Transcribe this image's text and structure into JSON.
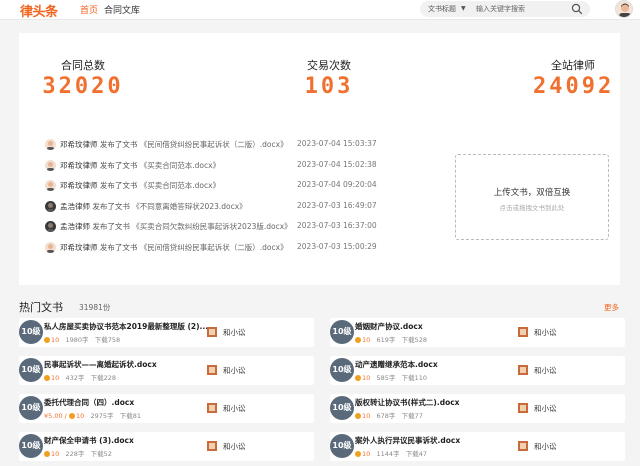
{
  "header": {
    "logo": "律头条",
    "nav": [
      "首页",
      "合同文库"
    ],
    "search_type": "文书标题",
    "search_placeholder": "输入关键字搜索"
  },
  "stats": [
    {
      "label": "合同总数",
      "value": "32020"
    },
    {
      "label": "交易次数",
      "value": "103"
    },
    {
      "label": "全站律师",
      "value": "24092"
    }
  ],
  "activity": [
    {
      "name": "邓希玟律师",
      "verb": "发布了文书",
      "doc": "《民间借贷纠纷民事起诉状（二版）.docx》",
      "time": "2023-07-04 15:03:37",
      "avatar": "light"
    },
    {
      "name": "邓希玟律师",
      "verb": "发布了文书",
      "doc": "《买卖合同范本.docx》",
      "time": "2023-07-04 15:02:38",
      "avatar": "light"
    },
    {
      "name": "邓希玟律师",
      "verb": "发布了文书",
      "doc": "《买卖合同范本.docx》",
      "time": "2023-07-04 09:20:04",
      "avatar": "light"
    },
    {
      "name": "孟浩律师",
      "verb": "发布了文书",
      "doc": "《不同意离婚答辩状2023.docx》",
      "time": "2023-07-03 16:49:07",
      "avatar": "dark"
    },
    {
      "name": "孟浩律师",
      "verb": "发布了文书",
      "doc": "《买卖合同欠款纠纷民事起诉状2023版.docx》",
      "time": "2023-07-03 16:37:00",
      "avatar": "dark"
    },
    {
      "name": "邓希玟律师",
      "verb": "发布了文书",
      "doc": "《民间借贷纠纷民事起诉状（二版）.docx》",
      "time": "2023-07-03 15:00:29",
      "avatar": "light"
    }
  ],
  "upload": {
    "title": "上传文书，双倍互换",
    "subtitle": "点击或拖拽文书到此处"
  },
  "hot": {
    "title": "热门文书",
    "count": "31981份",
    "more": "更多",
    "docs": [
      {
        "level": "10级",
        "title": "私人房屋买卖协议书范本2019最新整理版 (2)....",
        "points": "10",
        "price": "",
        "words": "1980字",
        "downloads": "下载758",
        "author": "和小讼"
      },
      {
        "level": "10级",
        "title": "婚姻财产协议.docx",
        "points": "10",
        "price": "",
        "words": "619字",
        "downloads": "下载528",
        "author": "和小讼"
      },
      {
        "level": "10级",
        "title": "民事起诉状——离婚起诉状.docx",
        "points": "10",
        "price": "",
        "words": "432字",
        "downloads": "下载228",
        "author": "和小讼"
      },
      {
        "level": "10级",
        "title": "动产遗赠继承范本.docx",
        "points": "10",
        "price": "",
        "words": "585字",
        "downloads": "下载110",
        "author": "和小讼"
      },
      {
        "level": "10级",
        "title": "委托代理合同（四）.docx",
        "points": "10",
        "price": "¥5.00 /",
        "words": "2975字",
        "downloads": "下载81",
        "author": "和小讼"
      },
      {
        "level": "10级",
        "title": "版权转让协议书(样式二).docx",
        "points": "10",
        "price": "",
        "words": "678字",
        "downloads": "下载77",
        "author": "和小讼"
      },
      {
        "level": "10级",
        "title": "财产保全申请书 (3).docx",
        "points": "10",
        "price": "",
        "words": "228字",
        "downloads": "下载52",
        "author": "和小讼"
      },
      {
        "level": "10级",
        "title": "案外人执行异议民事诉状.docx",
        "points": "10",
        "price": "",
        "words": "1144字",
        "downloads": "下载47",
        "author": "和小讼"
      }
    ]
  }
}
